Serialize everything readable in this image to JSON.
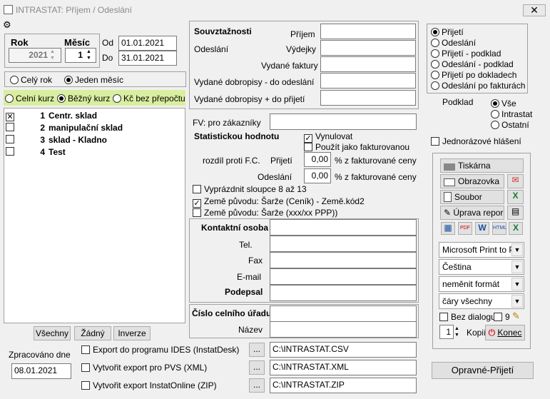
{
  "window": {
    "title": "INTRASTAT:  Příjem / Odeslání",
    "close": "✕"
  },
  "period": {
    "rok_label": "Rok",
    "rok_value": "2021",
    "mesic_label": "Měsíc",
    "mesic_value": "1",
    "od_label": "Od",
    "od_value": "01.01.2021",
    "do_label": "Do",
    "do_value": "31.01.2021"
  },
  "range": {
    "cely_rok": "Celý rok",
    "jeden_mesic": "Jeden měsíc"
  },
  "kurz": {
    "celni": "Celní kurz",
    "bezny": "Běžný kurz",
    "bez": "Kč bez přepočtu"
  },
  "warehouses": [
    {
      "num": "1",
      "name": "Centr. sklad",
      "checked": true
    },
    {
      "num": "2",
      "name": "manipulační sklad",
      "checked": false
    },
    {
      "num": "3",
      "name": "sklad - Kladno",
      "checked": false
    },
    {
      "num": "4",
      "name": "Test",
      "checked": false
    }
  ],
  "list_buttons": {
    "all": "Všechny",
    "none": "Žádný",
    "invert": "Inverze"
  },
  "processed": {
    "label": "Zpracováno dne",
    "value": "08.01.2021"
  },
  "souvz": {
    "title": "Souvztažnosti",
    "prijem": "Příjem",
    "odeslani": "Odeslání",
    "vydejky": "Výdejky",
    "vydane_faktury": "Vydané faktury",
    "dobr_minus": "Vydané dobropisy - do odeslání",
    "dobr_plus": "Vydané dobropisy + do přijetí"
  },
  "fv": {
    "label": "FV: pro zákazníky"
  },
  "stat": {
    "label": "Statistickou hodnotu",
    "vynulovat": "Vynulovat",
    "pouzit": "Použít jako fakturovanou",
    "rozdil": "rozdíl proti F.C.",
    "prijeti": "Přijetí",
    "prijeti_val": "0,00",
    "odeslani": "Odeslání",
    "odeslani_val": "0,00",
    "pct": "% z fakturované ceny"
  },
  "options": {
    "vyprazdnit": "Vyprázdnit sloupce 8 až 13",
    "zeme1": "Země původu: Šarže (Ceník) - Země.kód2",
    "zeme2": "Země původu: Šarže (xxx/xx PPP))"
  },
  "contact": {
    "title": "Kontaktní osoba",
    "tel": "Tel.",
    "fax": "Fax",
    "email": "E-mail",
    "podpis": "Podepsal"
  },
  "customs": {
    "title": "Číslo celního úřadu",
    "nazev": "Název"
  },
  "exports": [
    {
      "label": "Export do programu IDES (InstatDesk)",
      "path": "C:\\INTRASTAT.CSV"
    },
    {
      "label": "Vytvořit export pro PVS (XML)",
      "path": "C:\\INTRASTAT.XML"
    },
    {
      "label": "Vytvořit export InstatOnline (ZIP)",
      "path": "C:\\INTRASTAT.ZIP"
    }
  ],
  "browse": "...",
  "mode": [
    "Přijetí",
    "Odeslání",
    "Přijetí - podklad",
    "Odeslání - podklad",
    "Přijetí po dokladech",
    "Odeslání po fakturách"
  ],
  "podklad": {
    "label": "Podklad",
    "items": [
      "Vše",
      "Intrastat",
      "Ostatní"
    ]
  },
  "jednorazove": "Jednorázové hlášení",
  "print": {
    "tiskarna": "Tiskárna",
    "obrazovka": "Obrazovka",
    "soubor": "Soubor",
    "uprava": "Úprava repor",
    "printer": "Microsoft Print to PD",
    "lang": "Čeština",
    "format": "neměnit formát",
    "lines": "čáry všechny",
    "bez": "Bez dialogu",
    "nine": "9",
    "copies": "1",
    "kopii": "Kopií",
    "konec": "Konec"
  },
  "opravne": "Opravné-Přijetí",
  "colors": {
    "accent_band": "#d9eea0",
    "window_bg": "#f0f0f0"
  }
}
